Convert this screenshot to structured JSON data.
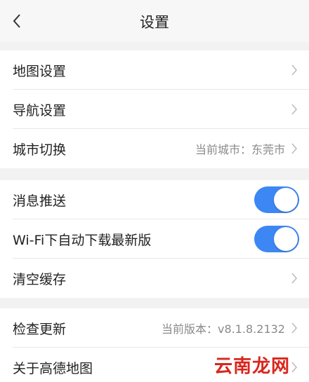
{
  "header": {
    "title": "设置"
  },
  "groups": [
    {
      "rows": [
        {
          "label": "地图设置"
        },
        {
          "label": "导航设置"
        },
        {
          "label": "城市切换",
          "value": "当前城市：东莞市"
        }
      ]
    },
    {
      "rows": [
        {
          "label": "消息推送",
          "toggle": true
        },
        {
          "label": "Wi-Fi下自动下载最新版",
          "toggle": true
        },
        {
          "label": "清空缓存"
        }
      ]
    },
    {
      "rows": [
        {
          "label": "检查更新",
          "value": "当前版本：v8.1.8.2132"
        },
        {
          "label": "关于高德地图"
        }
      ]
    }
  ],
  "watermark": "云南龙网",
  "colors": {
    "accent": "#3d87f5",
    "background": "#f2f2f2",
    "watermark": "#d9261c"
  },
  "icons": {
    "back": "chevron-left-icon",
    "row": "chevron-right-icon"
  }
}
